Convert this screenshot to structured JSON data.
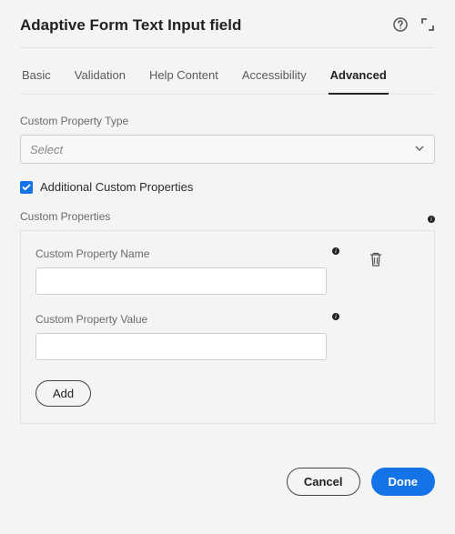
{
  "header": {
    "title": "Adaptive Form Text Input field"
  },
  "tabs": [
    {
      "label": "Basic",
      "active": false
    },
    {
      "label": "Validation",
      "active": false
    },
    {
      "label": "Help Content",
      "active": false
    },
    {
      "label": "Accessibility",
      "active": false
    },
    {
      "label": "Advanced",
      "active": true
    }
  ],
  "customPropertyType": {
    "label": "Custom Property Type",
    "placeholder": "Select"
  },
  "additionalCheckbox": {
    "checked": true,
    "label": "Additional Custom Properties"
  },
  "customPropsSection": {
    "label": "Custom Properties"
  },
  "card": {
    "nameLabel": "Custom Property Name",
    "nameValue": "",
    "valueLabel": "Custom Property Value",
    "valueValue": "",
    "addLabel": "Add"
  },
  "footer": {
    "cancel": "Cancel",
    "done": "Done"
  }
}
